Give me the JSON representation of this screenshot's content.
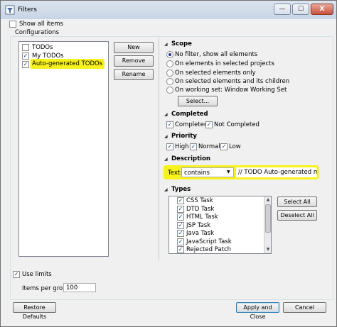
{
  "window": {
    "title": "Filters",
    "buttons": [
      "—",
      "☐",
      "X"
    ]
  },
  "show_all_items": {
    "label": "Show all items",
    "checked": false
  },
  "configurations": {
    "label": "Configurations",
    "items": [
      {
        "label": "TODOs",
        "checked": false
      },
      {
        "label": "My TODOs",
        "checked": true
      },
      {
        "label": "Auto-generated TODOs",
        "checked": true
      }
    ],
    "buttons": {
      "new": "New",
      "remove": "Remove",
      "rename": "Rename"
    }
  },
  "scope": {
    "label": "Scope",
    "options": [
      {
        "label": "No filter, show all elements",
        "selected": true
      },
      {
        "label": "On elements in selected projects",
        "selected": false
      },
      {
        "label": "On selected elements only",
        "selected": false
      },
      {
        "label": "On selected elements and its children",
        "selected": false
      },
      {
        "label": "On working set:  Window Working Set",
        "selected": false
      }
    ],
    "select_button": "Select..."
  },
  "completed": {
    "label": "Completed",
    "options": [
      {
        "label": "Completed",
        "checked": true
      },
      {
        "label": "Not Completed",
        "checked": true
      }
    ]
  },
  "priority": {
    "label": "Priority",
    "options": [
      {
        "label": "High",
        "checked": true
      },
      {
        "label": "Normal",
        "checked": true
      },
      {
        "label": "Low",
        "checked": true
      }
    ]
  },
  "description": {
    "label": "Description",
    "text_label": "Text:",
    "operator": "contains",
    "value": "// TODO Auto-generated metho"
  },
  "types": {
    "label": "Types",
    "items": [
      {
        "label": "CSS Task",
        "checked": true
      },
      {
        "label": "DTD Task",
        "checked": true
      },
      {
        "label": "HTML Task",
        "checked": true
      },
      {
        "label": "JSP Task",
        "checked": true
      },
      {
        "label": "Java Task",
        "checked": true
      },
      {
        "label": "JavaScript Task",
        "checked": true
      },
      {
        "label": "Rejected Patch",
        "checked": true
      }
    ],
    "buttons": {
      "select_all": "Select All",
      "deselect_all": "Deselect All"
    }
  },
  "limits": {
    "use_limits_label": "Use limits",
    "use_limits_checked": true,
    "items_per_group_label": "Items per group:",
    "items_per_group_value": "100"
  },
  "footer": {
    "restore_defaults": "Restore Defaults",
    "apply_and_close": "Apply and Close",
    "cancel": "Cancel"
  },
  "colors": {
    "highlight": "#f7f21c",
    "check": "#1a3a8a"
  },
  "icons": {
    "check": "✓",
    "dropdown": "▼",
    "triangle": "◢",
    "scroll_up": "▲",
    "scroll_down": "▼"
  }
}
